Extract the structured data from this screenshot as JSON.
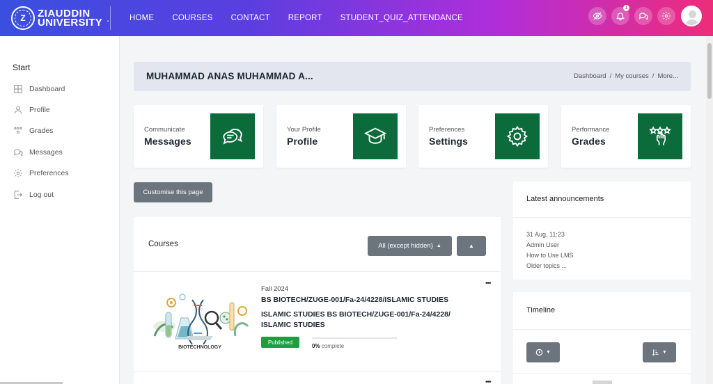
{
  "brand": {
    "seal_text": "Z",
    "line1": "ZIAUDDIN",
    "line2": "UNIVERSITY",
    "dot": "."
  },
  "nav": {
    "links": [
      "HOME",
      "COURSES",
      "CONTACT",
      "REPORT",
      "STUDENT_QUIZ_ATTENDANCE"
    ],
    "notification_count": "1"
  },
  "sidebar": {
    "title": "Start",
    "items": [
      {
        "label": "Dashboard",
        "icon": "dashboard-icon"
      },
      {
        "label": "Profile",
        "icon": "profile-icon"
      },
      {
        "label": "Grades",
        "icon": "grades-icon"
      },
      {
        "label": "Messages",
        "icon": "messages-icon"
      },
      {
        "label": "Preferences",
        "icon": "preferences-icon"
      },
      {
        "label": "Log out",
        "icon": "logout-icon"
      }
    ]
  },
  "header": {
    "title": "MUHAMMAD ANAS MUHAMMAD A...",
    "breadcrumbs": [
      "Dashboard",
      "My courses",
      "More..."
    ]
  },
  "quick_cards": [
    {
      "sub": "Communicate",
      "main": "Messages",
      "icon": "chat-bubbles-icon"
    },
    {
      "sub": "Your Profile",
      "main": "Profile",
      "icon": "graduation-cap-icon"
    },
    {
      "sub": "Preferences",
      "main": "Settings",
      "icon": "gear-icon"
    },
    {
      "sub": "Performance",
      "main": "Grades",
      "icon": "stars-hand-icon"
    }
  ],
  "customise_label": "Customise this page",
  "courses": {
    "title": "Courses",
    "filter_label": "All (except hidden)",
    "course": {
      "term": "Fall 2024",
      "short_name": "BS BIOTECH/ZUGE-001/Fa-24/4228/ISLAMIC STUDIES",
      "full_name": "ISLAMIC STUDIES BS BIOTECH/ZUGE-001/Fa-24/4228/ ISLAMIC STUDIES",
      "badge": "Published",
      "progress_value": "0%",
      "progress_suffix": " complete",
      "image_caption": "BIOTECHNOLOGY"
    }
  },
  "announcements": {
    "title": "Latest announcements",
    "date": "31 Aug, 11:23",
    "author": "Admin User",
    "subject": "How to Use LMS",
    "older": "Older topics ..."
  },
  "timeline": {
    "title": "Timeline"
  },
  "colors": {
    "tile_green": "#0b6b3a",
    "published_green": "#1f9d3f",
    "button_gray": "#6c757d"
  }
}
